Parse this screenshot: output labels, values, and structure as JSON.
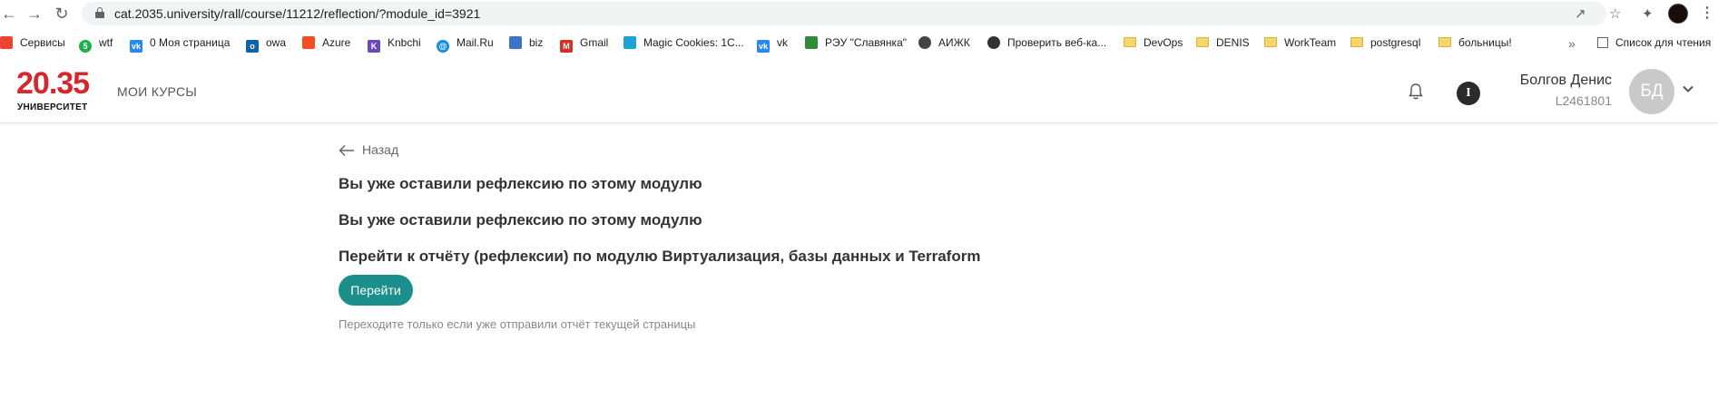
{
  "browser": {
    "url": "cat.2035.university/rall/course/11212/reflection/?module_id=3921",
    "bookmarks": [
      {
        "label": "Сервисы",
        "icon": "apps-grid-icon",
        "color": "#ea4335"
      },
      {
        "label": "wtf",
        "icon": "green-circle-icon",
        "color": "#20b04b"
      },
      {
        "label": "0 Моя страница",
        "icon": "vk-icon",
        "color": "#2787f5"
      },
      {
        "label": "owa",
        "icon": "outlook-icon",
        "color": "#0a64ad"
      },
      {
        "label": "Azure",
        "icon": "microsoft-icon",
        "color": "#f25022"
      },
      {
        "label": "Knbchi",
        "icon": "k-icon",
        "color": "#6b47b8"
      },
      {
        "label": "Mail.Ru",
        "icon": "mailru-icon",
        "color": "#168de2"
      },
      {
        "label": "biz",
        "icon": "chart-icon",
        "color": "#3b73c9"
      },
      {
        "label": "Gmail",
        "icon": "gmail-icon",
        "color": "#d93025"
      },
      {
        "label": "Magic Cookies: 1С...",
        "icon": "cookie-icon",
        "color": "#1aa3d6"
      },
      {
        "label": "vk",
        "icon": "vk-icon",
        "color": "#2787f5"
      },
      {
        "label": "РЭУ \"Славянка\"",
        "icon": "leaf-icon",
        "color": "#2e8b3a"
      },
      {
        "label": "АИЖК",
        "icon": "globe-icon",
        "color": "#444444"
      },
      {
        "label": "Проверить веб-ка...",
        "icon": "webcam-icon",
        "color": "#333333"
      },
      {
        "label": "DevOps",
        "icon": "folder-icon",
        "color": "#f6d66a"
      },
      {
        "label": "DENIS",
        "icon": "folder-icon",
        "color": "#f6d66a"
      },
      {
        "label": "WorkTeam",
        "icon": "folder-icon",
        "color": "#f6d66a"
      },
      {
        "label": "postgresql",
        "icon": "folder-icon",
        "color": "#f6d66a"
      },
      {
        "label": "больницы!",
        "icon": "folder-icon",
        "color": "#f6d66a"
      }
    ],
    "reading_list": "Список для чтения"
  },
  "header": {
    "logo_number": "20.35",
    "logo_subtitle": "УНИВЕРСИТЕТ",
    "nav_my_courses": "МОИ КУРСЫ",
    "info_letter": "I",
    "user_name": "Болгов Денис",
    "user_id": "L2461801",
    "avatar_initials": "БД",
    "brand_color": "#d7262c"
  },
  "main": {
    "back_label": "Назад",
    "message_1": "Вы уже оставили рефлексию по этому модулю",
    "message_2": "Вы уже оставили рефлексию по этому модулю",
    "go_prompt": "Перейти к отчёту (рефлексии) по модулю Виртуализация, базы данных и Terraform",
    "go_button": "Перейти",
    "hint": "Переходите только если уже отправили отчёт текущей страницы",
    "accent_color": "#1a8f8b"
  }
}
